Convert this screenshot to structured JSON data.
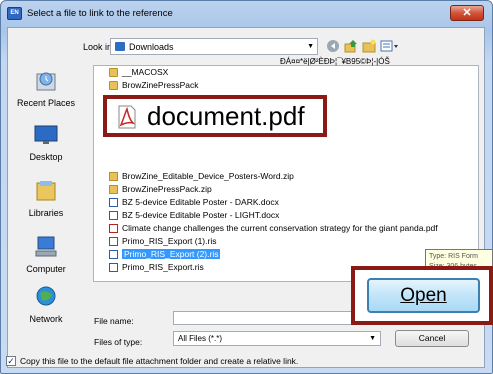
{
  "window": {
    "title": "Select a file to link to the reference",
    "app_icon_text": "EN",
    "close_symbol": "✕"
  },
  "lookin": {
    "label": "Look in:",
    "value": "Downloads"
  },
  "places": [
    {
      "label": "Recent Places",
      "icon": "recent-places-icon"
    },
    {
      "label": "Desktop",
      "icon": "desktop-icon"
    },
    {
      "label": "Libraries",
      "icon": "libraries-icon"
    },
    {
      "label": "Computer",
      "icon": "computer-icon"
    },
    {
      "label": "Network",
      "icon": "network-icon"
    }
  ],
  "files": [
    {
      "name": "__MACOSX",
      "kind": "folder"
    },
    {
      "name": "BrowZinePressPack",
      "kind": "folder"
    },
    {
      "name": "BrowZine_Editable_Device_Posters-Word.zip",
      "kind": "zip"
    },
    {
      "name": "BrowZinePressPack.zip",
      "kind": "zip"
    },
    {
      "name": "BZ 5-device Editable Poster - DARK.docx",
      "kind": "docx"
    },
    {
      "name": "BZ 5-device Editable Poster - LIGHT.docx",
      "kind": "docx"
    },
    {
      "name": "Climate change challenges the current conservation strategy for the giant panda.pdf",
      "kind": "pdf"
    },
    {
      "name": "Primo_RIS_Export (1).ris",
      "kind": "ris"
    },
    {
      "name": "Primo_RIS_Export (2).ris",
      "kind": "ris"
    },
    {
      "name": "Primo_RIS_Export.ris",
      "kind": "ris"
    }
  ],
  "garbled_text": "ÐÁ¤¤*ë|Ø²ÈÐÞ¦¯¥B95©Þ¦-|ÓŠ",
  "callout": {
    "document_name": "document.pdf"
  },
  "tooltip": {
    "line1": "Type: RIS Form",
    "line2": "Size: 306 bytes"
  },
  "filename": {
    "label": "File name:",
    "value": ""
  },
  "filetype": {
    "label": "Files of type:",
    "value": "All Files (*.*)"
  },
  "buttons": {
    "open": "Open",
    "cancel": "Cancel"
  },
  "checkbox": {
    "checked": true,
    "label": "Copy this file to the default file attachment folder and create a relative link."
  }
}
